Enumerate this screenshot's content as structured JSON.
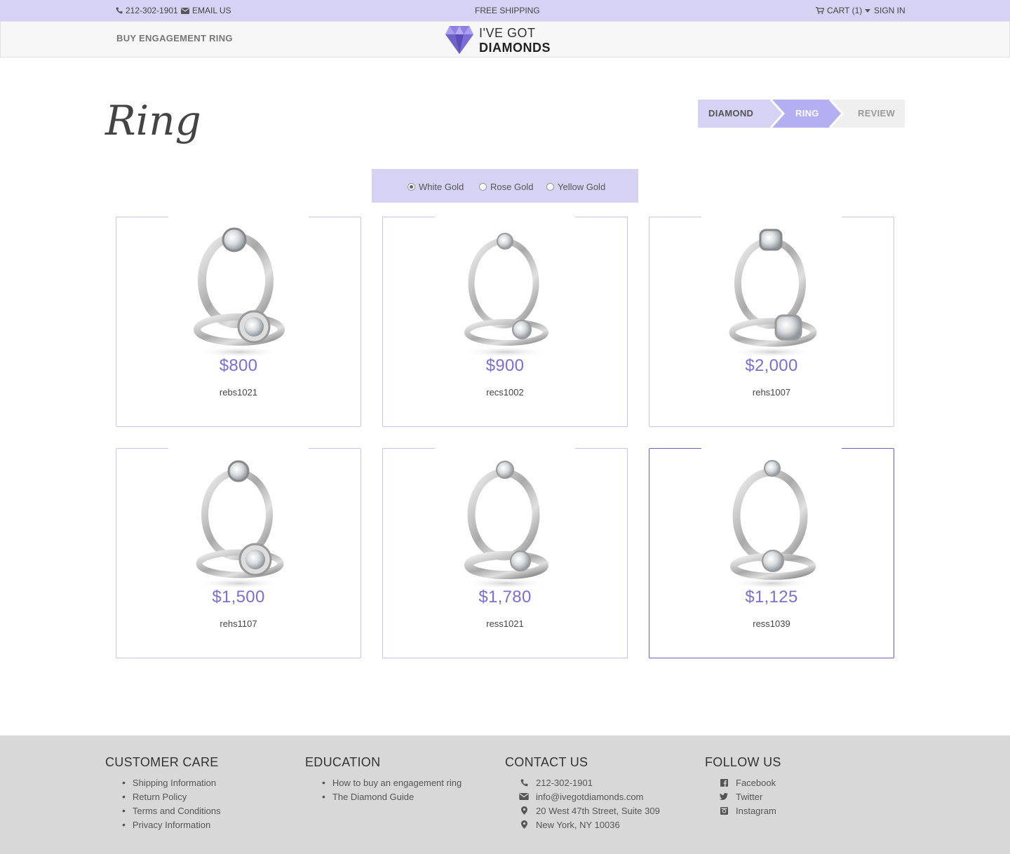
{
  "topbar": {
    "phone": "212-302-1901",
    "email_label": "EMAIL US",
    "promo": "FREE SHIPPING",
    "cart_label": "CART (1)",
    "signin_label": "SIGN IN"
  },
  "header": {
    "nav_label": "BUY ENGAGEMENT RING",
    "logo_line1": "I'VE GOT",
    "logo_line2": "DIAMONDS"
  },
  "page": {
    "title": "Ring"
  },
  "stepper": {
    "steps": [
      {
        "label": "DIAMOND",
        "state": "done"
      },
      {
        "label": "RING",
        "state": "current"
      },
      {
        "label": "REVIEW",
        "state": "upcoming"
      }
    ]
  },
  "metal_filter": {
    "selected": "White Gold",
    "options": [
      {
        "label": "White Gold"
      },
      {
        "label": "Rose Gold"
      },
      {
        "label": "Yellow Gold"
      }
    ]
  },
  "products": [
    {
      "price": "$800",
      "sku": "rebs1021",
      "style": "halo-milgrain"
    },
    {
      "price": "$900",
      "sku": "recs1002",
      "style": "solitaire-pave"
    },
    {
      "price": "$2,000",
      "sku": "rehs1007",
      "style": "cushion-halo"
    },
    {
      "price": "$1,500",
      "sku": "rehs1107",
      "style": "round-halo"
    },
    {
      "price": "$1,780",
      "sku": "ress1021",
      "style": "cathedral-solitaire"
    },
    {
      "price": "$1,125",
      "sku": "ress1039",
      "style": "plain-solitaire"
    }
  ],
  "footer": {
    "customer_care": {
      "heading": "CUSTOMER CARE",
      "links": [
        "Shipping Information",
        "Return Policy",
        "Terms and Conditions",
        "Privacy Information"
      ]
    },
    "education": {
      "heading": "EDUCATION",
      "links": [
        "How to buy an engagement ring",
        "The Diamond Guide"
      ]
    },
    "contact": {
      "heading": "CONTACT US",
      "items": [
        {
          "icon": "phone-icon",
          "text": "212-302-1901"
        },
        {
          "icon": "envelope-icon",
          "text": "info@ivegotdiamonds.com"
        },
        {
          "icon": "map-marker-icon",
          "text": "20 West 47th Street, Suite 309"
        },
        {
          "icon": "map-marker-icon",
          "text": "New York, NY 10036"
        }
      ]
    },
    "follow": {
      "heading": "FOLLOW US",
      "items": [
        {
          "icon": "facebook-icon",
          "text": "Facebook"
        },
        {
          "icon": "twitter-icon",
          "text": "Twitter"
        },
        {
          "icon": "instagram-icon",
          "text": "Instagram"
        }
      ]
    }
  },
  "colors": {
    "accent": "#d5d2f4",
    "price": "#7a6fd0",
    "card_border": "#c7c2ee",
    "footer_bg": "#d8d8d8"
  }
}
